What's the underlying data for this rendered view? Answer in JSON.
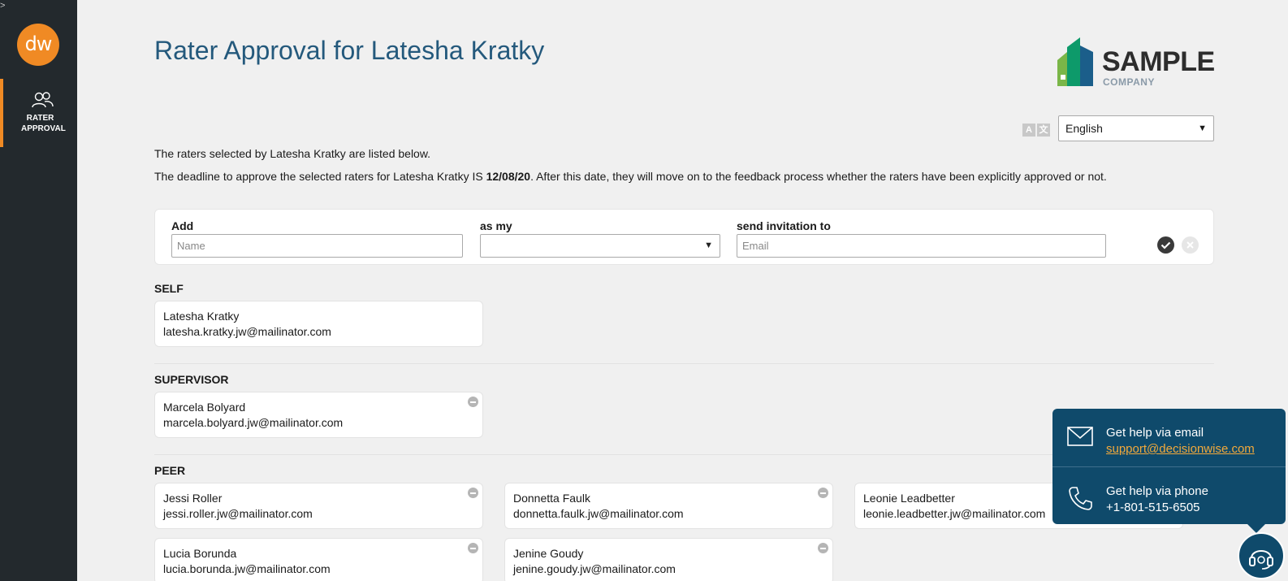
{
  "sidebar": {
    "cursor_glyph": ">",
    "logo_text": "dw",
    "nav_item_label": "RATER APPROVAL"
  },
  "header": {
    "title": "Rater Approval for Latesha Kratky",
    "brand_name": "SAMPLE",
    "brand_sub": "COMPANY"
  },
  "language": {
    "selected": "English",
    "icon_letters": [
      "A",
      "文"
    ]
  },
  "intro": {
    "line1": "The raters selected by Latesha Kratky are listed below.",
    "line2_before": "The deadline to approve the selected raters for Latesha Kratky IS ",
    "line2_date": "12/08/20",
    "line2_after": ". After this date, they will move on to the feedback process whether the raters have been explicitly approved or not."
  },
  "add_form": {
    "add_label": "Add",
    "name_placeholder": "Name",
    "as_my_label": "as my",
    "relationship_value": "",
    "send_label": "send invitation to",
    "email_placeholder": "Email"
  },
  "sections": {
    "self": {
      "title": "SELF",
      "raters": [
        {
          "name": "Latesha Kratky",
          "email": "latesha.kratky.jw@mailinator.com"
        }
      ]
    },
    "supervisor": {
      "title": "SUPERVISOR",
      "raters": [
        {
          "name": "Marcela Bolyard",
          "email": "marcela.bolyard.jw@mailinator.com"
        }
      ]
    },
    "peer": {
      "title": "PEER",
      "raters": [
        {
          "name": "Jessi Roller",
          "email": "jessi.roller.jw@mailinator.com"
        },
        {
          "name": "Donnetta Faulk",
          "email": "donnetta.faulk.jw@mailinator.com"
        },
        {
          "name": "Leonie Leadbetter",
          "email": "leonie.leadbetter.jw@mailinator.com"
        },
        {
          "name": "Lucia Borunda",
          "email": "lucia.borunda.jw@mailinator.com"
        },
        {
          "name": "Jenine Goudy",
          "email": "jenine.goudy.jw@mailinator.com"
        }
      ]
    }
  },
  "help": {
    "email_heading": "Get help via email",
    "email_address": "support@decisionwise.com",
    "phone_heading": "Get help via phone",
    "phone_number": "+1-801-515-6505"
  },
  "colors": {
    "sidebar_bg": "#23292d",
    "accent_orange": "#f08a24",
    "title_blue": "#24597c",
    "help_bg": "#0f4a6b",
    "help_link": "#f2a93b"
  }
}
